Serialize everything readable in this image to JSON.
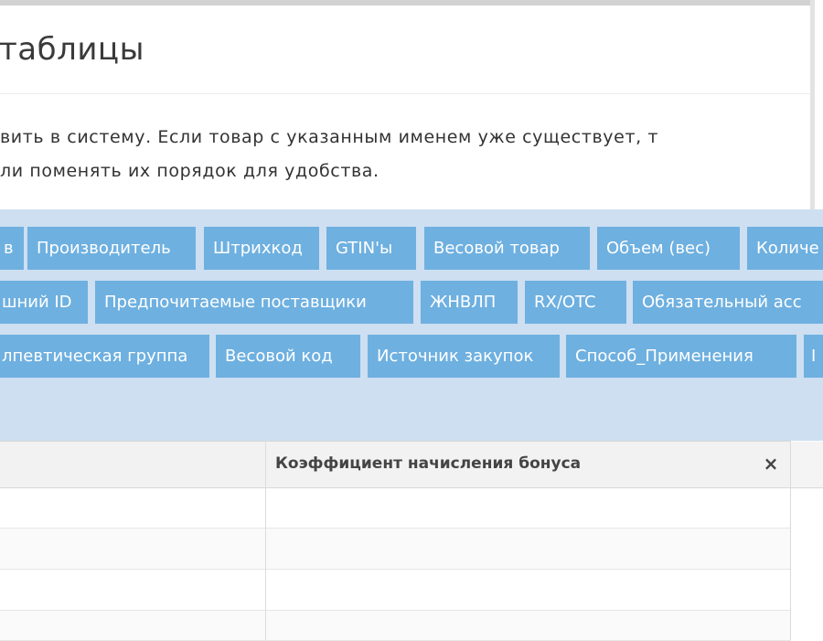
{
  "header": {
    "title": "таблицы"
  },
  "description": {
    "line1": "вить в систему. Если товар с указанным именем уже существует, т",
    "line2": "ли поменять их порядок для удобства."
  },
  "chips": {
    "row0": [
      "в",
      "Производитель",
      "Штрихкод",
      "GTIN'ы",
      "Весовой товар",
      "Объем (вес)",
      "Количе"
    ],
    "row1": [
      "шний ID",
      "Предпочитаемые поставщики",
      "ЖНВЛП",
      "RX/OTC",
      "Обязательный асс"
    ],
    "row2": [
      "лпевтическая группа",
      "Весовой код",
      "Источник закупок",
      "Способ_Применения",
      "I"
    ]
  },
  "table": {
    "columns": [
      {
        "label": ""
      },
      {
        "label": "Коэффициент начисления бонуса",
        "close": "×"
      }
    ],
    "rows": [
      {
        "cells": [
          "",
          ""
        ]
      },
      {
        "cells": [
          "",
          ""
        ]
      },
      {
        "cells": [
          "",
          ""
        ]
      },
      {
        "cells": [
          "",
          ""
        ]
      }
    ]
  },
  "colors": {
    "chip": "#6eb0e0",
    "chip_panel": "#cddff1",
    "table_header": "#f2f2f2"
  }
}
